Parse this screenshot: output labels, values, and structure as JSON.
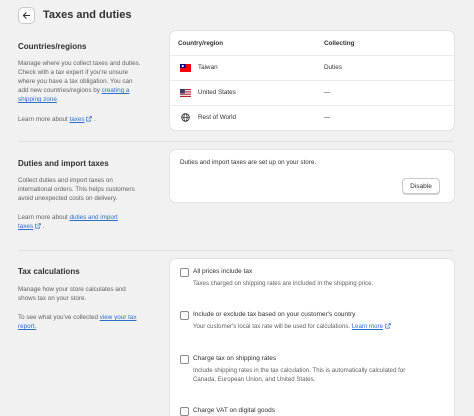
{
  "header": {
    "title": "Taxes and duties"
  },
  "countries": {
    "title": "Countries/regions",
    "desc_1": "Manage where you collect taxes and duties.",
    "desc_2": "Check with a tax expert if you're unsure",
    "desc_3": "where you have a tax obligation. You can",
    "desc_4_pre": "add new countries/regions by ",
    "desc_4_link": "creating a",
    "desc_5_link": "shipping zone",
    "desc_5_post": ".",
    "learn_pre": "Learn more about ",
    "learn_link": "taxes",
    "learn_post": ".",
    "table": {
      "col_country": "Country/region",
      "col_collecting": "Collecting",
      "rows": [
        {
          "country": "Taiwan",
          "collecting": "Duties",
          "icon": "taiwan-flag-icon"
        },
        {
          "country": "United States",
          "collecting": "—",
          "icon": "us-flag-icon"
        },
        {
          "country": "Rest of World",
          "collecting": "—",
          "icon": "globe-icon"
        }
      ]
    }
  },
  "duties": {
    "title": "Duties and import taxes",
    "desc_1": "Collect duties and import taxes on",
    "desc_2": "international orders. This helps customers",
    "desc_3": "avoid unexpected costs on delivery.",
    "learn_pre": "Learn more about ",
    "learn_link_1": "duties and import",
    "learn_link_2": "taxes",
    "learn_post": ".",
    "card_text": "Duties and import taxes are set up on your store.",
    "disable_label": "Disable"
  },
  "tax_calc": {
    "title": "Tax calculations",
    "desc_1": "Manage how your store calculates and",
    "desc_2": "shows tax on your store.",
    "collected_pre": "To see what you've collected ",
    "collected_link_1": "view your tax",
    "collected_link_2": "report.",
    "options": [
      {
        "label": "All prices include tax",
        "help": [
          "Taxes charged on shipping rates are included in the shipping price."
        ]
      },
      {
        "label": "Include or exclude tax based on your customer's country",
        "help": [
          "Your customer's local tax rate will be used for calculations."
        ],
        "learn_link": "Learn more"
      },
      {
        "label": "Charge tax on shipping rates",
        "help": [
          "Include shipping rates in the tax calculation. This is automatically calculated for",
          "Canada, European Union, and United States."
        ]
      },
      {
        "label": "Charge VAT on digital goods",
        "help": []
      }
    ]
  },
  "colors": {
    "link": "#2c6ecb",
    "background": "#f1f1f1",
    "text": "#303030",
    "muted": "#616161"
  }
}
